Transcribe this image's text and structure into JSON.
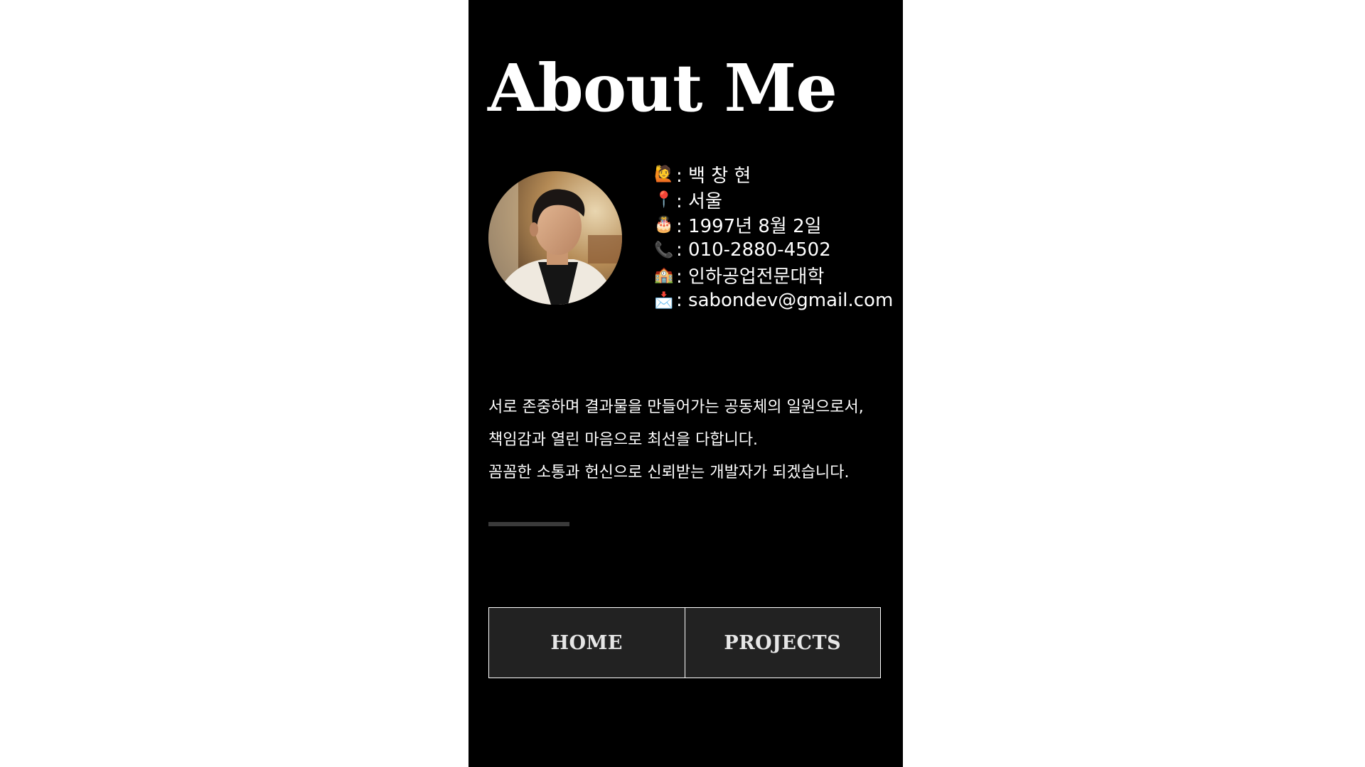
{
  "page": {
    "title": "About Me"
  },
  "profile": {
    "items": [
      {
        "icon": "person-raising-hand-icon",
        "glyph": "🙋",
        "value": ": 백 창 현"
      },
      {
        "icon": "pushpin-icon",
        "glyph": "📍",
        "value": ": 서울"
      },
      {
        "icon": "birthday-cake-icon",
        "glyph": "🎂",
        "value": ": 1997년 8월 2일"
      },
      {
        "icon": "telephone-icon",
        "glyph": "📞",
        "value": ": 010-2880-4502"
      },
      {
        "icon": "school-icon",
        "glyph": "🏫",
        "value": ": 인하공업전문대학"
      },
      {
        "icon": "envelope-icon",
        "glyph": "📩",
        "value": ": sabondev@gmail.com"
      }
    ]
  },
  "bio": {
    "lines": [
      "서로 존중하며 결과물을 만들어가는 공동체의 일원으로서,",
      "책임감과 열린 마음으로 최선을 다합니다.",
      "꼼꼼한 소통과 헌신으로 신뢰받는 개발자가 되겠습니다."
    ]
  },
  "nav": {
    "home_label": "HOME",
    "projects_label": "PROJECTS"
  },
  "colors": {
    "panel_background": "#000000",
    "page_background": "#ffffff",
    "text": "#ffffff",
    "button_background": "#222222",
    "button_text": "#e6e6e6",
    "divider": "#3a3a3a"
  }
}
